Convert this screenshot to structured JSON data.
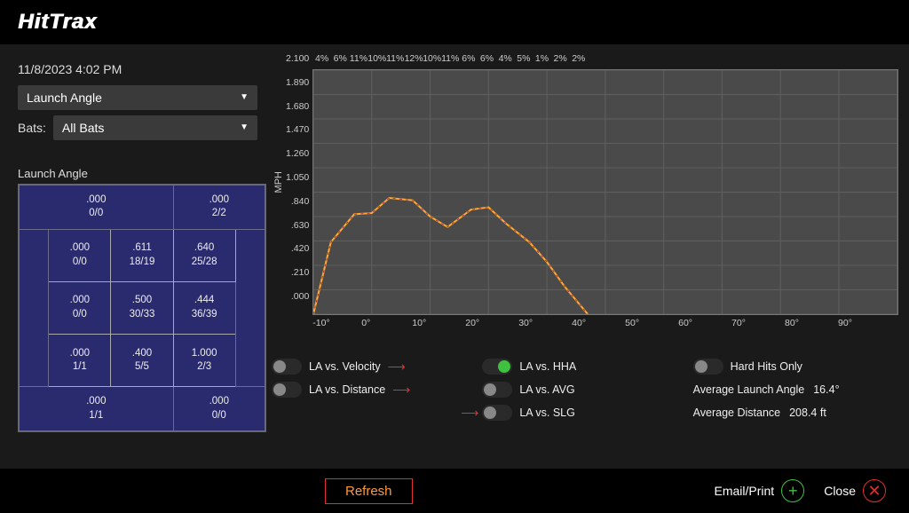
{
  "brand": "HitTrax",
  "timestamp": "11/8/2023 4:02 PM",
  "metric_select": {
    "value": "Launch Angle"
  },
  "bats": {
    "label": "Bats:",
    "value": "All Bats"
  },
  "panel_title": "Launch Angle",
  "zone": {
    "outer_top_left": {
      "avg": ".000",
      "count": "0/0"
    },
    "outer_top_right": {
      "avg": ".000",
      "count": "2/2"
    },
    "outer_bot_left": {
      "avg": ".000",
      "count": "1/1"
    },
    "outer_bot_right": {
      "avg": ".000",
      "count": "0/0"
    },
    "inner": [
      [
        {
          "avg": ".000",
          "count": "0/0"
        },
        {
          "avg": ".611",
          "count": "18/19"
        },
        {
          "avg": ".640",
          "count": "25/28"
        }
      ],
      [
        {
          "avg": ".000",
          "count": "0/0"
        },
        {
          "avg": ".500",
          "count": "30/33"
        },
        {
          "avg": ".444",
          "count": "36/39"
        }
      ],
      [
        {
          "avg": ".000",
          "count": "1/1"
        },
        {
          "avg": ".400",
          "count": "5/5"
        },
        {
          "avg": "1.000",
          "count": "2/3"
        }
      ]
    ]
  },
  "chart_data": {
    "type": "line",
    "title": "",
    "ylabel": "MPH",
    "xlabel": "",
    "xlim": [
      -10,
      90
    ],
    "ylim": [
      0,
      2.1
    ],
    "x_ticks": [
      "-10°",
      "0°",
      "10°",
      "20°",
      "30°",
      "40°",
      "50°",
      "60°",
      "70°",
      "80°",
      "90°"
    ],
    "y_ticks": [
      "2.100",
      "1.890",
      "1.680",
      "1.470",
      "1.260",
      "1.050",
      ".840",
      ".630",
      ".420",
      ".210",
      ".000"
    ],
    "top_percent_labels": [
      "4%",
      "6%",
      "11%",
      "10%",
      "11%",
      "12%",
      "10%",
      "11%",
      "6%",
      "6%",
      "4%",
      "5%",
      "1%",
      "2%",
      "2%"
    ],
    "series": [
      {
        "name": "LA vs. HHA",
        "color": "#ffaa33",
        "x": [
          -10,
          -7,
          -3,
          0,
          3,
          7,
          10,
          13,
          17,
          20,
          23,
          27,
          30,
          33,
          37
        ],
        "y": [
          0.0,
          0.62,
          0.86,
          0.87,
          1.0,
          0.98,
          0.84,
          0.75,
          0.9,
          0.92,
          0.78,
          0.62,
          0.45,
          0.24,
          0.0
        ]
      }
    ]
  },
  "toggles": {
    "la_velocity": {
      "label": "LA vs. Velocity",
      "on": false
    },
    "la_distance": {
      "label": "LA vs. Distance",
      "on": false
    },
    "la_hha": {
      "label": "LA vs. HHA",
      "on": true
    },
    "la_avg": {
      "label": "LA vs. AVG",
      "on": false
    },
    "la_slg": {
      "label": "LA vs. SLG",
      "on": false
    },
    "hard_hits": {
      "label": "Hard Hits Only",
      "on": false
    }
  },
  "stats": {
    "avg_la": {
      "label": "Average Launch Angle",
      "value": "16.4°"
    },
    "avg_dist": {
      "label": "Average Distance",
      "value": "208.4 ft"
    }
  },
  "footer": {
    "refresh": "Refresh",
    "email_print": "Email/Print",
    "close": "Close"
  }
}
